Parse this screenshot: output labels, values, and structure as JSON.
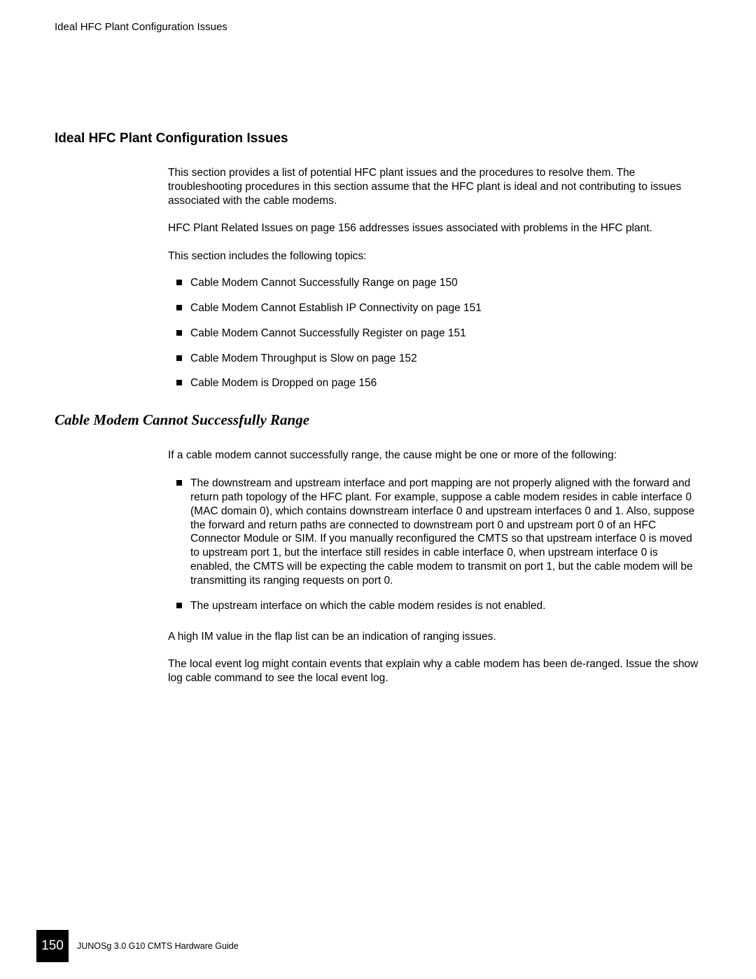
{
  "header": {
    "running_title": "Ideal HFC Plant Configuration Issues"
  },
  "section": {
    "heading": "Ideal HFC Plant Configuration Issues",
    "intro_1": "This section provides a list of potential HFC plant issues and the procedures to resolve them. The troubleshooting procedures in this section assume that the HFC plant is ideal and not contributing to issues associated with the cable modems.",
    "intro_2": " HFC Plant Related Issues  on page 156 addresses issues associated with problems in the HFC plant.",
    "topics_lead": "This section includes the following topics:",
    "topics": [
      "Cable Modem Cannot Successfully Range on page 150",
      "Cable Modem Cannot Establish IP Connectivity on page 151",
      "Cable Modem Cannot Successfully Register on page 151",
      "Cable Modem Throughput is Slow on page 152",
      "Cable Modem is Dropped on page 156"
    ]
  },
  "subsection": {
    "heading": "Cable Modem Cannot Successfully Range",
    "lead": "If a cable modem cannot successfully range, the cause might be one or more of the following:",
    "causes": [
      "The downstream and upstream interface and port mapping are not properly aligned with the forward and return path topology of the HFC plant. For example, suppose a cable modem resides in cable interface 0 (MAC domain 0), which contains downstream interface 0 and upstream interfaces 0 and 1. Also, suppose the forward and return paths are connected to downstream port 0 and upstream port 0 of an HFC Connector Module or SIM. If you manually reconfigured the CMTS so that upstream interface 0 is moved to upstream port 1, but the interface still resides in cable interface 0, when upstream interface 0 is enabled, the CMTS will be expecting the cable modem to transmit on port 1, but the cable modem will be transmitting its ranging requests on port 0.",
      "The upstream interface on which the cable modem resides is not enabled."
    ],
    "para_1": "A high IM value in the flap list can be an indication of ranging issues.",
    "para_2": "The local event log might contain events that explain why a cable modem has been de-ranged. Issue the show log cable command to see the local event log."
  },
  "footer": {
    "page_number": "150",
    "book_title": "JUNOSg 3.0 G10 CMTS Hardware Guide"
  }
}
